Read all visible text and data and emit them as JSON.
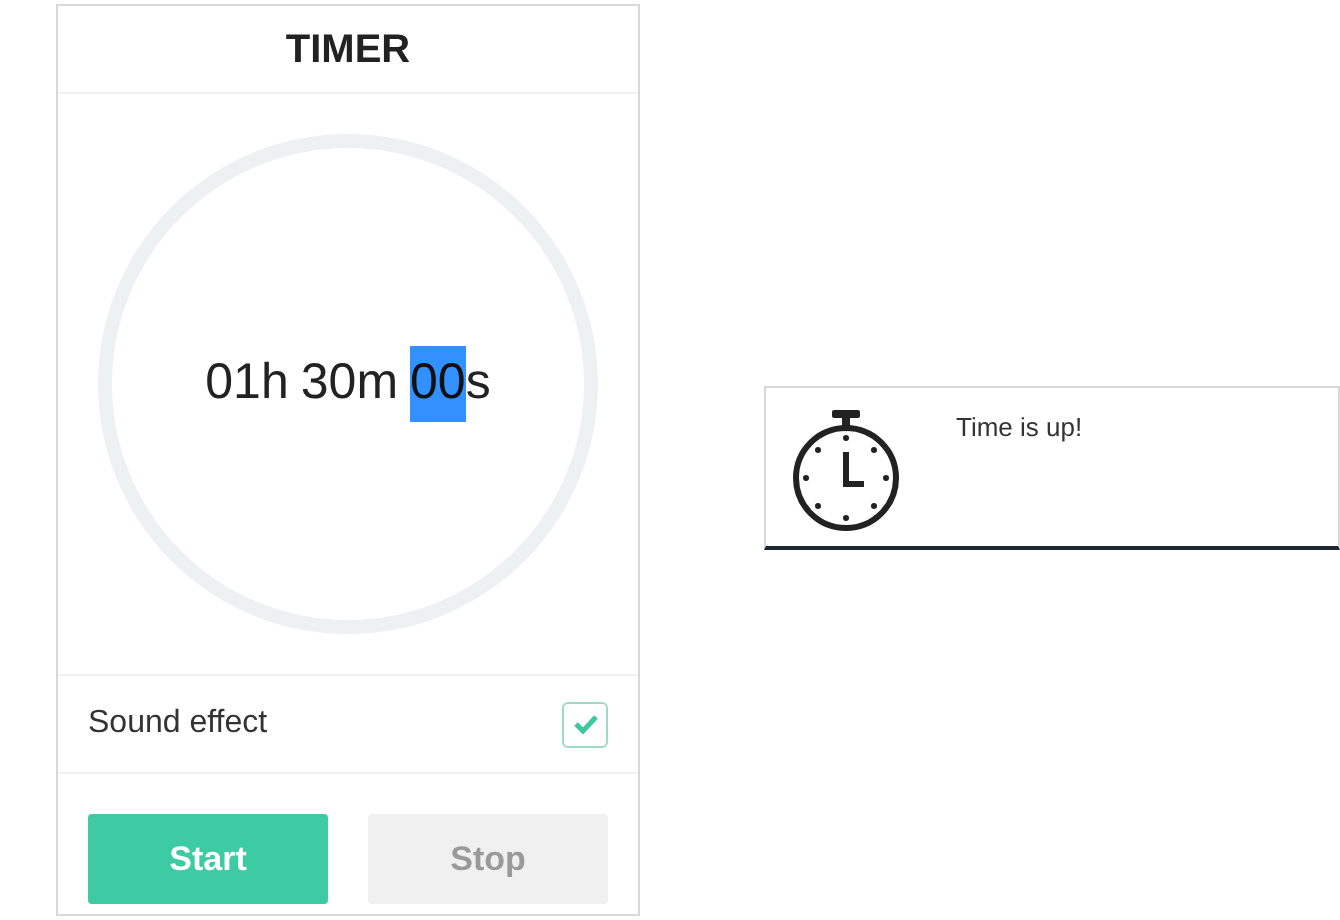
{
  "timer": {
    "title": "TIMER",
    "segments": [
      {
        "value": "01",
        "unit": "h",
        "selected": false
      },
      {
        "value": "30",
        "unit": "m",
        "selected": false
      },
      {
        "value": "00",
        "unit": "s",
        "selected": true
      }
    ],
    "sound_effect": {
      "label": "Sound effect",
      "checked": true
    },
    "buttons": [
      {
        "label": "Start",
        "disabled": false,
        "kind": "primary"
      },
      {
        "label": "Stop",
        "disabled": true,
        "kind": "secondary"
      }
    ]
  },
  "notification": {
    "message": "Time is up!"
  }
}
